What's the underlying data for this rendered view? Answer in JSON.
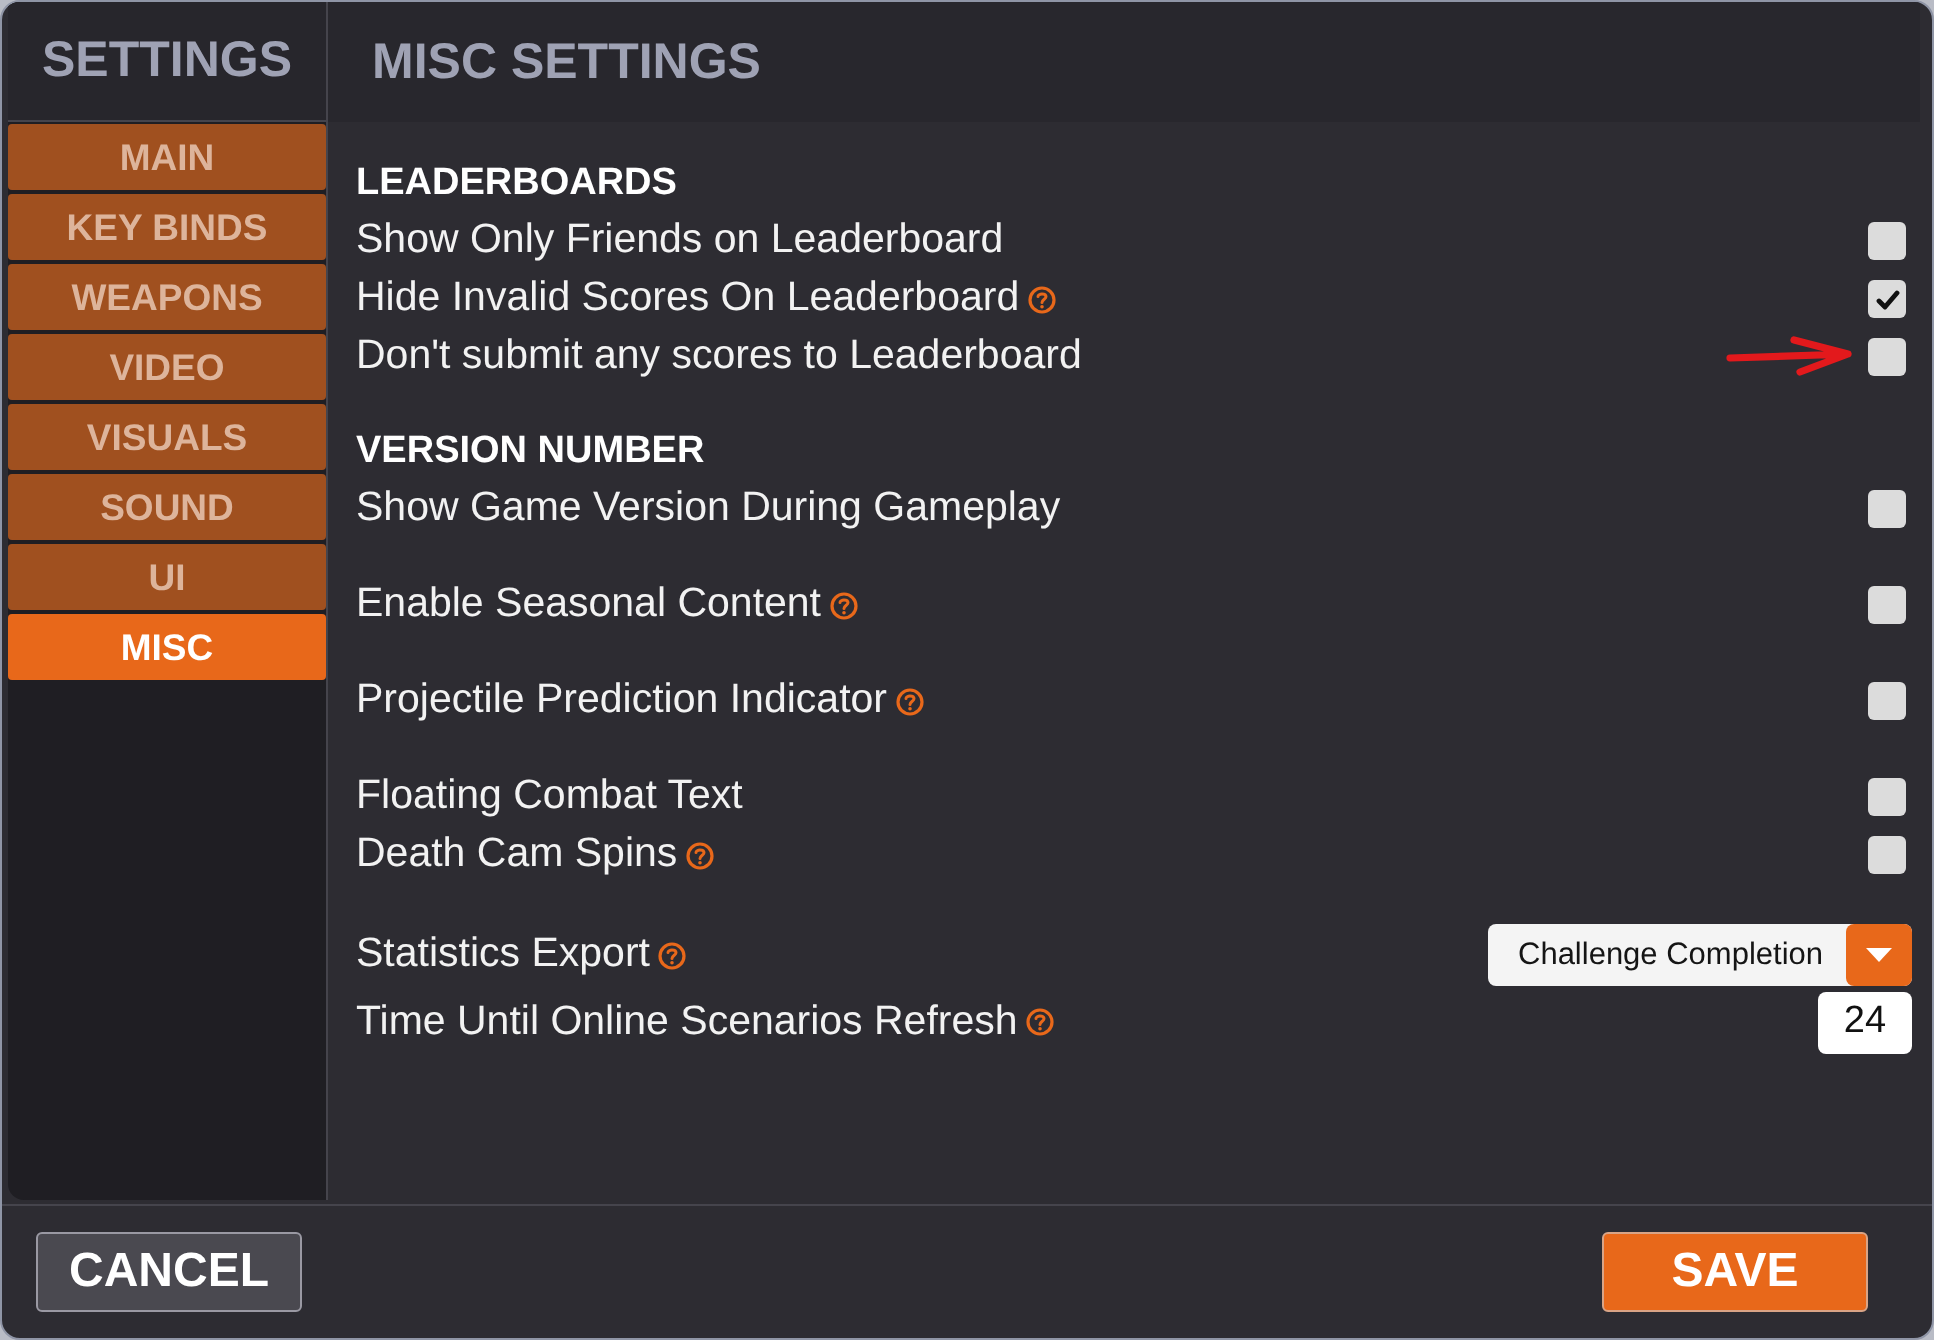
{
  "sidebar": {
    "title": "SETTINGS",
    "tabs": [
      {
        "label": "MAIN",
        "selected": false
      },
      {
        "label": "KEY BINDS",
        "selected": false
      },
      {
        "label": "WEAPONS",
        "selected": false
      },
      {
        "label": "VIDEO",
        "selected": false
      },
      {
        "label": "VISUALS",
        "selected": false
      },
      {
        "label": "SOUND",
        "selected": false
      },
      {
        "label": "UI",
        "selected": false
      },
      {
        "label": "MISC",
        "selected": true
      }
    ]
  },
  "header": {
    "title": "MISC SETTINGS"
  },
  "groups": [
    {
      "title": "LEADERBOARDS",
      "rows": [
        {
          "kind": "checkbox",
          "label": "Show Only Friends on Leaderboard",
          "help": false,
          "checked": false,
          "arrow": false
        },
        {
          "kind": "checkbox",
          "label": "Hide Invalid Scores On Leaderboard",
          "help": true,
          "checked": true,
          "arrow": false
        },
        {
          "kind": "checkbox",
          "label": "Don't submit any scores to Leaderboard",
          "help": false,
          "checked": false,
          "arrow": true
        }
      ]
    },
    {
      "title": "VERSION NUMBER",
      "rows": [
        {
          "kind": "checkbox",
          "label": "Show Game Version During Gameplay",
          "help": false,
          "checked": false,
          "arrow": false
        }
      ]
    },
    {
      "rows": [
        {
          "kind": "checkbox",
          "label": "Enable Seasonal Content",
          "help": true,
          "checked": false,
          "arrow": false
        }
      ]
    },
    {
      "rows": [
        {
          "kind": "checkbox",
          "label": "Projectile Prediction Indicator",
          "help": true,
          "checked": false,
          "arrow": false
        }
      ]
    },
    {
      "rows": [
        {
          "kind": "checkbox",
          "label": "Floating Combat Text",
          "help": false,
          "checked": false,
          "arrow": false
        },
        {
          "kind": "checkbox",
          "label": "Death Cam Spins",
          "help": true,
          "checked": false,
          "arrow": false
        }
      ]
    },
    {
      "rows": [
        {
          "kind": "dropdown",
          "label": "Statistics Export",
          "help": true,
          "value": "Challenge Completion",
          "arrow": false
        },
        {
          "kind": "number",
          "label": "Time Until Online Scenarios Refresh",
          "help": true,
          "value": "24",
          "arrow": false
        }
      ]
    }
  ],
  "footer": {
    "buttons": [
      {
        "kind": "secondary",
        "label": "CANCEL"
      },
      {
        "kind": "primary",
        "label": "SAVE"
      }
    ]
  }
}
